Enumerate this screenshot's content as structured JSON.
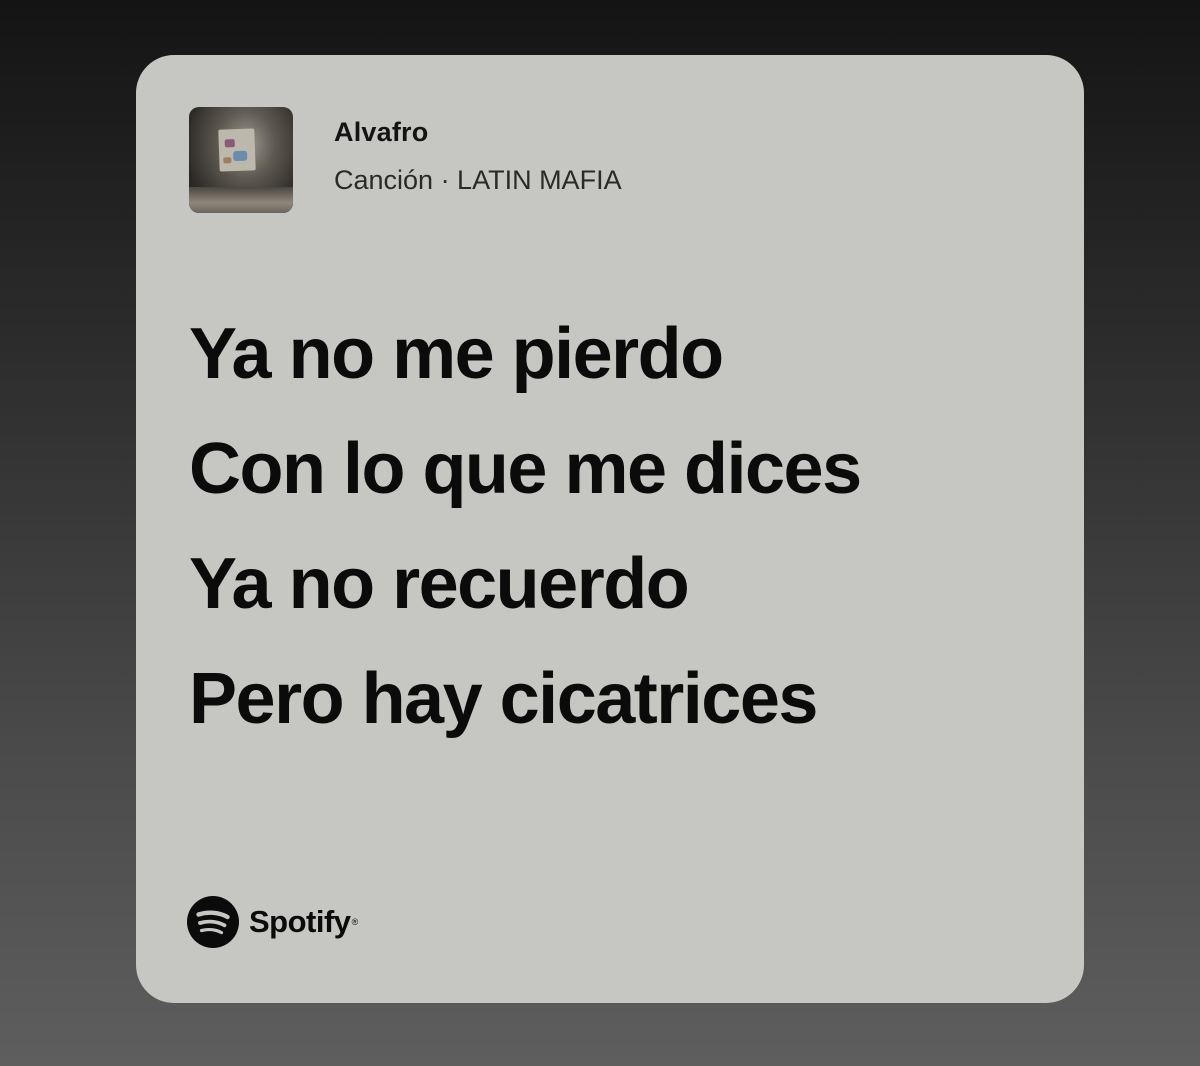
{
  "track": {
    "title": "Alvafro",
    "subtitle": "Canción · LATIN MAFIA",
    "cover_icon": "album-cover-image"
  },
  "lyrics": {
    "lines": [
      "Ya no me pierdo",
      "Con lo que me dices",
      "Ya no recuerdo",
      "Pero hay cicatrices"
    ]
  },
  "brand": {
    "name": "Spotify",
    "trademark": "®",
    "icon": "spotify-logo-icon"
  },
  "colors": {
    "card_background": "#c6c7c2",
    "text": "#0b0b0b",
    "page_background_top": "#141414",
    "page_background_bottom": "#5e5e5e"
  }
}
